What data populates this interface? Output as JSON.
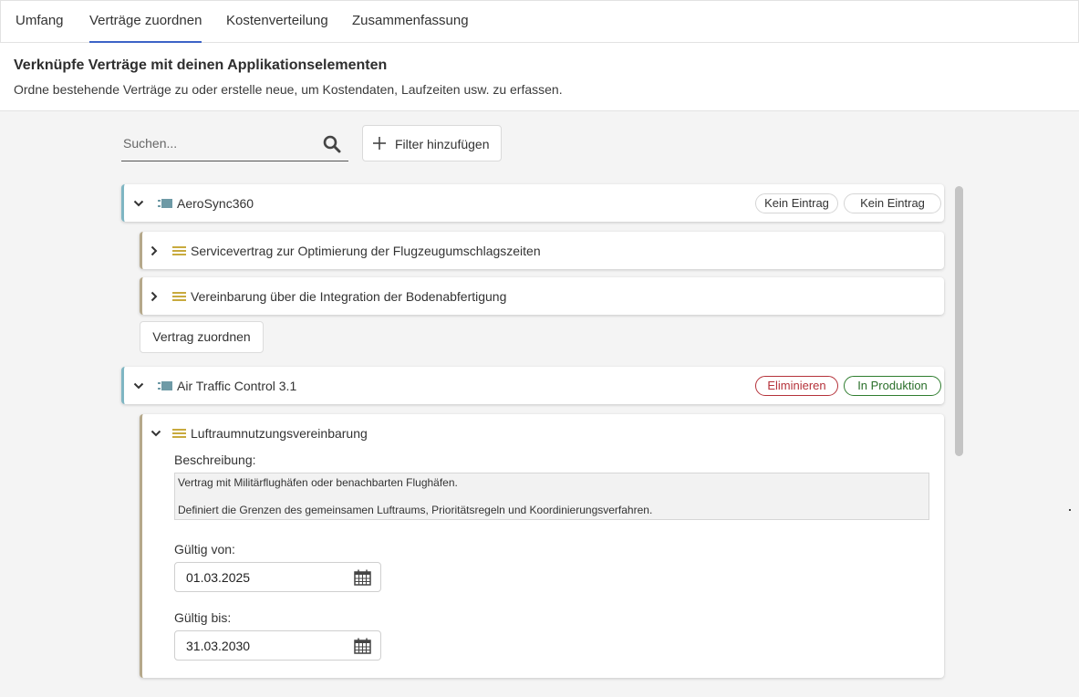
{
  "tabs": [
    {
      "label": "Umfang"
    },
    {
      "label": "Verträge zuordnen"
    },
    {
      "label": "Kostenverteilung"
    },
    {
      "label": "Zusammenfassung"
    }
  ],
  "header": {
    "title": "Verknüpfe Verträge mit deinen Applikationselementen",
    "subtitle": "Ordne bestehende Verträge zu oder erstelle neue, um Kostendaten, Laufzeiten usw. zu erfassen."
  },
  "toolbar": {
    "search_placeholder": "Suchen...",
    "filter_label": "Filter hinzufügen"
  },
  "apps": [
    {
      "name": "AeroSync360",
      "badges": [
        "Kein Eintrag",
        "Kein Eintrag"
      ],
      "contracts": [
        {
          "name": "Servicevertrag zur Optimierung der Flugzeugumschlagszeiten"
        },
        {
          "name": "Vereinbarung über die Integration der Bodenabfertigung"
        }
      ],
      "assign_label": "Vertrag zuordnen"
    },
    {
      "name": "Air Traffic Control 3.1",
      "badges": [
        "Eliminieren",
        "In Produktion"
      ],
      "contracts": [
        {
          "name": "Luftraumnutzungsvereinbarung",
          "description_label": "Beschreibung:",
          "description_line1": "Vertrag mit Militärflughäfen oder benachbarten Flughäfen.",
          "description_line2": "Definiert die Grenzen des gemeinsamen Luftraums, Prioritätsregeln und Koordinierungsverfahren.",
          "valid_from_label": "Gültig von:",
          "valid_from": "01.03.2025",
          "valid_to_label": "Gültig bis:",
          "valid_to": "31.03.2030"
        }
      ]
    }
  ],
  "colors": {
    "accent": "#3d63c7",
    "app_border": "#7fb6c3",
    "contract_border": "#b5a88a",
    "badge_red": "#b5323a",
    "badge_green": "#2f7d2f"
  }
}
